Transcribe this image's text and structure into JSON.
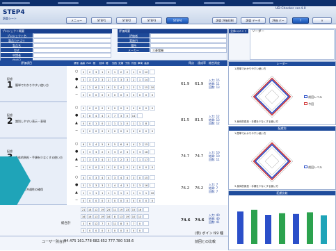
{
  "app": {
    "name": "UD-Checker",
    "version": "ver.4.0"
  },
  "step": {
    "title": "STEP4",
    "subtitle": "調査シート"
  },
  "nav_buttons": [
    "メニュー",
    "STEP1",
    "STEP2",
    "STEP3",
    "STEP4"
  ],
  "action_buttons": [
    "調査 評価印刷",
    "調査 データ",
    "評価 バー"
  ],
  "info": {
    "project_label": "プロジェクト概要",
    "eval_label": "評価概要",
    "fields_left": [
      "プロジェクト名",
      "製品カテゴリ",
      "製品名",
      "型式",
      "申請者",
      "作成日"
    ],
    "fields_right": [
      "評価者",
      "実施日",
      "場所",
      "メーカー"
    ],
    "maker": "三菱電機",
    "summary_label": "全体コメント",
    "summary_value": "リーダー"
  },
  "table_header": {
    "item": "評価項目",
    "points": "得点",
    "rate": "達成率",
    "judge": "総合判定"
  },
  "column_letters": [
    "健常",
    "高齢",
    "PoR",
    "視",
    "肢体",
    "聴",
    "知的",
    "妊婦",
    "子供",
    "外国",
    "車椅",
    "高身"
  ],
  "sections": [
    {
      "label": "配慮",
      "num": "1",
      "name": "簡単でわかりやすい使い方",
      "points": "61.9",
      "rate": "61.9",
      "side": [
        "入力: 15",
        "結果: 11",
        "回数: 13"
      ],
      "rows": [
        [
          "2",
          "2",
          "3",
          "1",
          "3",
          "1",
          "2",
          "2",
          "1",
          "3",
          "12",
          ""
        ],
        [
          "3",
          "3",
          "2",
          "3",
          "2",
          "3",
          "3",
          "3",
          "2",
          "1",
          "14",
          ""
        ],
        [
          "4",
          "2",
          "6",
          "5",
          "6",
          "5",
          "4",
          "1",
          "3",
          "1",
          "15",
          "10"
        ],
        [
          "0",
          "0",
          "0",
          "0",
          "0",
          "0",
          "0",
          "0",
          "0",
          "0",
          "0",
          "0"
        ]
      ]
    },
    {
      "label": "配慮",
      "num": "2",
      "name": "識別しやすい表示・表現",
      "points": "81.5",
      "rate": "81.5",
      "side": [
        "入力: 12",
        "結果: 13",
        "回数: 12"
      ],
      "rows": [
        [
          "0",
          "0",
          "0",
          "0",
          "0",
          "0",
          "0",
          "0",
          "0",
          "0",
          "0",
          "0"
        ],
        [
          "4",
          "8",
          "4",
          "4",
          "2",
          "7",
          "3",
          "0",
          "14",
          ""
        ],
        [
          "0",
          "0",
          "1",
          "0",
          "1",
          "1",
          "1",
          "0",
          "1",
          "1",
          "8",
          ""
        ],
        [
          "0",
          "0",
          "0",
          "0",
          "0",
          "0",
          "0",
          "0",
          "0",
          "0",
          "0",
          "0"
        ]
      ]
    },
    {
      "label": "配慮",
      "num": "3",
      "name": "身体的負担・手順を少なくする使い方",
      "points": "74.7",
      "rate": "74.7",
      "side": [
        "入力: 10",
        "結果: 10",
        "回数: 11"
      ],
      "rows": [
        [
          "6",
          "5",
          "4",
          "5",
          "6",
          "5",
          "6",
          "6",
          "4",
          "2",
          "15",
          ""
        ],
        [
          "3",
          "3",
          "3",
          "2",
          "3",
          "3",
          "2",
          "3",
          "3",
          "3",
          "16",
          ""
        ],
        [
          "2",
          "3",
          "3",
          "4",
          "3",
          "3",
          "2",
          "3",
          "2",
          "1",
          "17",
          ""
        ],
        [
          "0",
          "0",
          "0",
          "0",
          "0",
          "0",
          "0",
          "0",
          "0",
          "0",
          "0",
          "0"
        ]
      ]
    },
    {
      "label": "配慮",
      "num": "4",
      "name": "安全性と共通性の確保",
      "points": "76.2",
      "rate": "76.2",
      "side": [
        "入力: 7",
        "結果: 7",
        "回数: 7"
      ],
      "rows": [
        [
          "4",
          "4",
          "3",
          "4",
          "4",
          "3",
          "4",
          "4",
          "3",
          "0",
          "15",
          ""
        ],
        [
          "3",
          "3",
          "3",
          "3",
          "2",
          "4",
          "4",
          "3",
          "3",
          "3",
          "16",
          ""
        ],
        [
          "1",
          "1",
          "1",
          "1",
          "1",
          "1",
          "1",
          "1",
          "1",
          "1",
          "1",
          "10"
        ],
        [
          "0",
          "0",
          "0",
          "0",
          "0",
          "0",
          "0",
          "0",
          "0",
          "0",
          "0",
          "0"
        ]
      ]
    }
  ],
  "total": {
    "label": "総合計",
    "points": "74.6",
    "rate": "74.6",
    "side": [
      "入力: 40",
      "結果: 40",
      "回数: 41"
    ],
    "rows": [
      [
        "21",
        "18",
        "12",
        "19",
        "25",
        "11",
        "19",
        "23",
        "15",
        "16",
        ""
      ],
      [
        "16",
        "16",
        "13",
        "19",
        "16",
        "8",
        "13",
        "19",
        "10",
        "13",
        ""
      ],
      [
        "3",
        "6",
        "12",
        "7",
        "4",
        "11",
        "8",
        "5",
        "7",
        "0",
        ""
      ],
      [
        "0",
        "0",
        "0",
        "0",
        "0",
        "0",
        "0",
        "0",
        "0",
        "0",
        ""
      ]
    ]
  },
  "footer": {
    "users": "ユーザー別合計",
    "values": "94.475 161.778 682.652 777.780 538.6",
    "compare": "前回との比較",
    "points_label": "(表) ポイント",
    "points_value": "19 種"
  },
  "charts": {
    "chart1_title": "レーダー",
    "chart2_title": "配慮別",
    "chart3_title": "配慮比較",
    "legend": [
      "前回レベル",
      "今回"
    ],
    "axis_top": "1.簡単でわかりやすい使い方",
    "axis_bottom": "3.身体的負担・手順を少なくする使い方",
    "colors": {
      "red": "#d23c3c",
      "blue": "#2b4fc9",
      "green": "#2ca24e",
      "teal": "#1fa4b8"
    },
    "bar_values": [
      0.78,
      0.82,
      0.7,
      0.74,
      0.72,
      0.76,
      0.69
    ]
  }
}
